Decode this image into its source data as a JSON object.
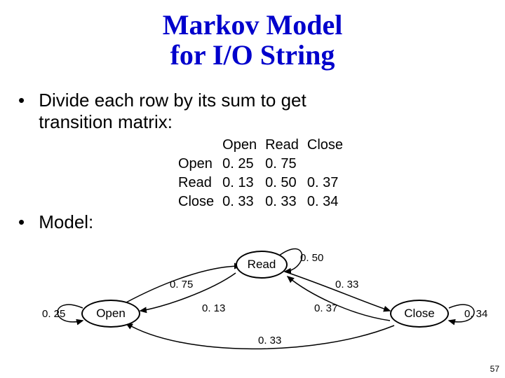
{
  "title": {
    "line1": "Markov Model",
    "line2": "for I/O String"
  },
  "bullets": {
    "b1a": "Divide each row by its sum to get",
    "b1b": "transition matrix:",
    "b2": "Model:"
  },
  "matrix": {
    "col1": "Open",
    "col2": "Read",
    "col3": "Close",
    "row1": "Open",
    "row2": "Read",
    "row3": "Close",
    "v11": "0. 25",
    "v12": "0. 75",
    "v13": "",
    "v21": "0. 13",
    "v22": "0. 50",
    "v23": "0. 37",
    "v31": "0. 33",
    "v32": "0. 33",
    "v33": "0. 34"
  },
  "nodes": {
    "open": "Open",
    "read": "Read",
    "close": "Close"
  },
  "edges": {
    "open_self": "0. 25",
    "open_read": "0. 75",
    "read_open": "0. 13",
    "read_self": "0. 50",
    "read_close": "0. 37",
    "close_read": "0. 33",
    "close_open": "0. 33",
    "close_self": "0. 34"
  },
  "pagenum": "57"
}
